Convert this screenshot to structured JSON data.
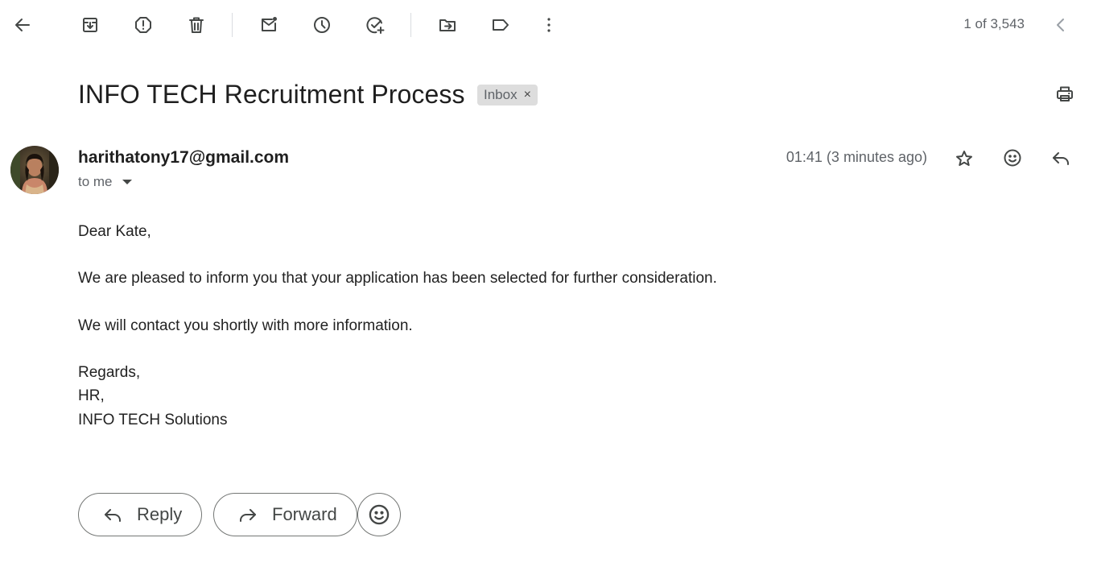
{
  "toolbar": {
    "icons": [
      "back-arrow-icon",
      "archive-icon",
      "report-spam-icon",
      "delete-icon",
      "mark-unread-icon",
      "snooze-icon",
      "add-to-tasks-icon",
      "move-to-icon",
      "labels-icon",
      "more-icon"
    ],
    "pager_text": "1 of 3,543"
  },
  "email": {
    "subject": "INFO TECH Recruitment Process",
    "label": "Inbox",
    "label_remove": "×",
    "sender": "harithatony17@gmail.com",
    "recipient": "to me",
    "timestamp": "01:41 (3 minutes ago)",
    "body": {
      "greeting": "Dear Kate,",
      "paragraph1": "We are pleased to inform you that your application has been selected for further consideration.",
      "paragraph2": "We will contact you shortly with more information.",
      "signoff": "Regards,",
      "signature_line1": "HR,",
      "signature_line2": "INFO TECH Solutions"
    }
  },
  "actions": {
    "reply_label": "Reply",
    "forward_label": "Forward"
  }
}
